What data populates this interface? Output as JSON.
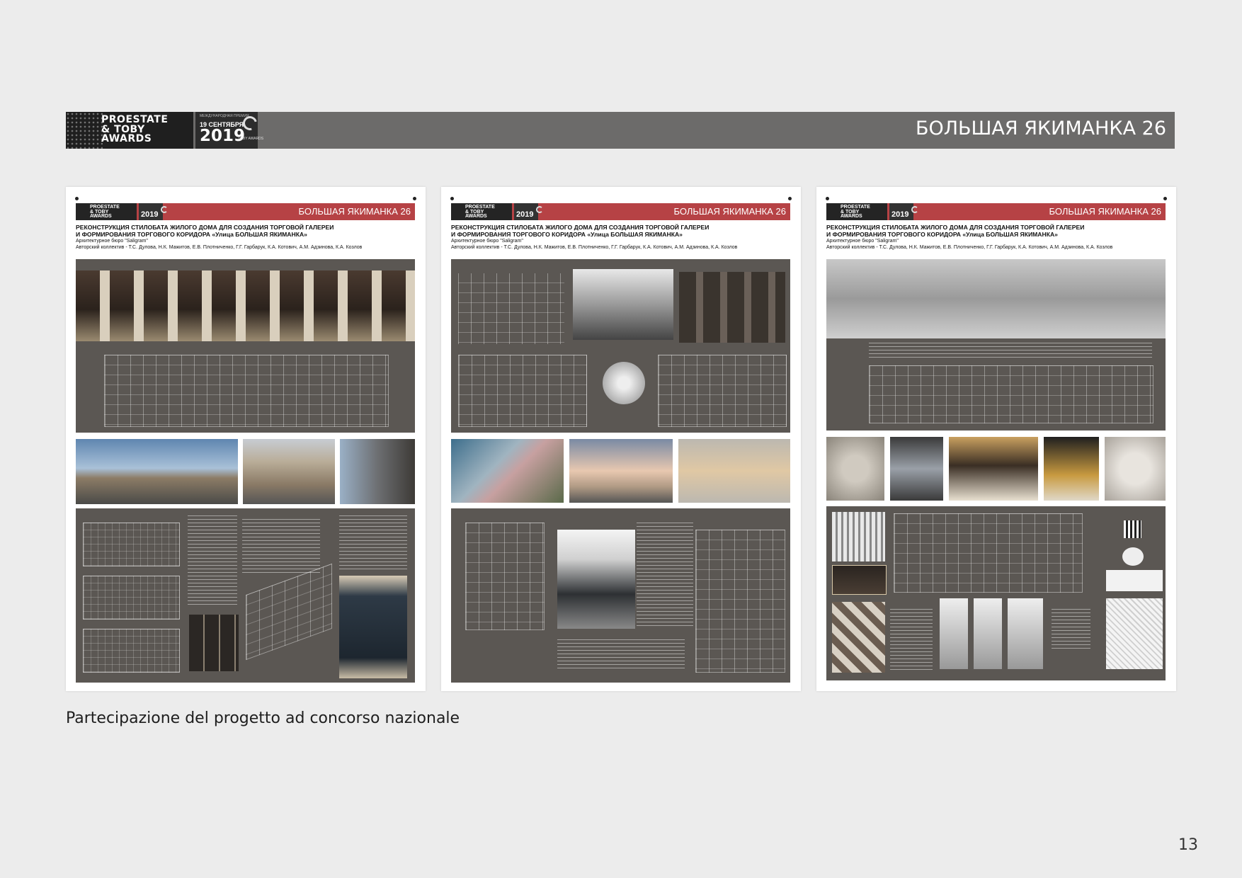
{
  "header": {
    "logo_text": "PROESTATE\n& TOBY\nAWARDS",
    "date_small": "МЕЖДУНАРОДНАЯ ПРЕМИЯ",
    "date_day": "19 СЕНТЯБРЯ",
    "date_year": "2019",
    "toby_label": "TOBY AWARDS",
    "title": "БОЛЬШАЯ ЯКИМАНКА 26"
  },
  "posters": [
    {
      "logo_text": "PROESTATE\n& TOBY\nAWARDS",
      "year": "2019",
      "title": "БОЛЬШАЯ ЯКИМАНКА 26",
      "heading_1": "РЕКОНСТРУКЦИЯ СТИЛОБАТА ЖИЛОГО ДОМА ДЛЯ СОЗДАНИЯ ТОРГОВОЙ ГАЛЕРЕИ",
      "heading_2": "И ФОРМИРОВАНИЯ ТОРГОВОГО КОРИДОРА «Улица БОЛЬШАЯ ЯКИМАНКА»",
      "bureau": "Архитектурное бюро \"Saligram\"",
      "authors": "Авторский коллектив - Т.С. Дулова, Н.К. Мажитов, Е.В. Плотниченко, Г.Г. Гарбарук, К.А. Котович, А.М. Адзинова, К.А. Козлов"
    },
    {
      "logo_text": "PROESTATE\n& TOBY\nAWARDS",
      "year": "2019",
      "title": "БОЛЬШАЯ ЯКИМАНКА 26",
      "heading_1": "РЕКОНСТРУКЦИЯ СТИЛОБАТА ЖИЛОГО ДОМА ДЛЯ СОЗДАНИЯ ТОРГОВОЙ ГАЛЕРЕИ",
      "heading_2": "И ФОРМИРОВАНИЯ ТОРГОВОГО КОРИДОРА «Улица БОЛЬШАЯ ЯКИМАНКА»",
      "bureau": "Архитектурное бюро \"Saligram\"",
      "authors": "Авторский коллектив - Т.С. Дулова, Н.К. Мажитов, Е.В. Плотниченко, Г.Г. Гарбарук, К.А. Котович, А.М. Адзинова, К.А. Козлов"
    },
    {
      "logo_text": "PROESTATE\n& TOBY\nAWARDS",
      "year": "2019",
      "title": "БОЛЬШАЯ ЯКИМАНКА 26",
      "heading_1": "РЕКОНСТРУКЦИЯ СТИЛОБАТА ЖИЛОГО ДОМА ДЛЯ СОЗДАНИЯ ТОРГОВОЙ ГАЛЕРЕИ",
      "heading_2": "И ФОРМИРОВАНИЯ ТОРГОВОГО КОРИДОРА «Улица БОЛЬШАЯ ЯКИМАНКА»",
      "bureau": "Архитектурное бюро \"Saligram\"",
      "authors": "Авторский коллектив - Т.С. Дулова, Н.К. Мажитов, Е.В. Плотниченко, Г.Г. Гарбарук, К.А. Котович, А.М. Адзинова, К.А. Козлов"
    }
  ],
  "colors": {
    "background": "#ececec",
    "banner": "#6c6b6a",
    "poster_header": "#b64245",
    "panel": "#5b5753"
  },
  "caption": "Partecipazione del progetto ad concorso nazionale",
  "page_number": "13"
}
